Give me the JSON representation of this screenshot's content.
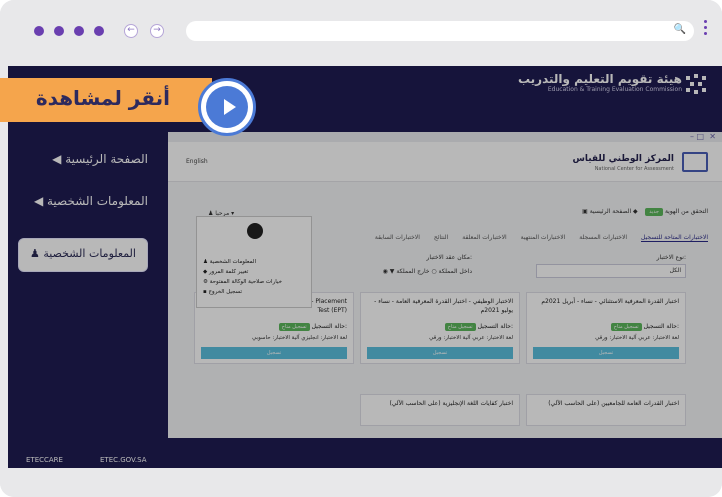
{
  "browser": {
    "back_icon": "←",
    "forward_icon": "→",
    "search_icon": "🔍"
  },
  "brand": {
    "arabic": "هيئة تقويم التعليم والتدريب",
    "english": "Education & Training Evaluation Commission"
  },
  "cta": {
    "label": "أنقر لمشاهدة"
  },
  "sidebar": {
    "items": [
      {
        "label": "◀ الصفحة الرئيسية"
      },
      {
        "label": "◀ المعلومات الشخصية"
      }
    ],
    "active_label": "♟ المعلومات الشخصية"
  },
  "footer": {
    "link1": "ETECCARE",
    "link2": "ETEC.GOV.SA"
  },
  "app": {
    "header_ar": "المركز الوطني للقياس",
    "header_en": "National Center for Assessment",
    "lang_label": "English",
    "crumb_home": "◆ الصفحة الرئيسية",
    "crumb_badge": "جديد",
    "crumb_link": "▣ التحقق من الهوية",
    "user_label": "♟ مرحبا ▾",
    "tabs": [
      "الاختبارات المتاحة للتسجيل",
      "الاختبارات المسجلة",
      "الاختبارات المنتهية",
      "الاختبارات المعلقة",
      "النتائج",
      "الاختبارات السابقة"
    ],
    "filter_type_label": "نوع الاختبار:",
    "filter_type_value": "الكل",
    "filter_place_label": "مكان عقد الاختبار:",
    "filter_place_value": "◉ ▼ داخل المملكة    ○ خارج المملكة"
  },
  "cards": [
    {
      "title": "اختبار القدرة المعرفية الاستثنائي - نساء - أبريل 2021م",
      "status_label": "حالة التسجيل:",
      "status_badge": "تسجيل متاح",
      "meta": "لغة الاختبار: عربي    آلية الاختبار: ورقي",
      "button": "تسجيل"
    },
    {
      "title": "الاختبار الوظيفي - اختبار القدرة المعرفية العامة - نساء - يوليو 2021م",
      "status_label": "حالة التسجيل:",
      "status_badge": "تسجيل متاح",
      "meta": "لغة الاختبار: عربي    آلية الاختبار: ورقي",
      "button": "تسجيل"
    },
    {
      "title": "اختبار تحديد مستوى اللغة الإنجليزية - EPT - Placement Test (EPT)",
      "status_label": "حالة التسجيل:",
      "status_badge": "تسجيل متاح",
      "meta": "لغة الاختبار: انجليزي    آلية الاختبار: حاسوبي",
      "button": "تسجيل"
    },
    {
      "title": "اختبار القدرات العامة للجامعيين (على الحاسب الآلي)",
      "status_label": "",
      "status_badge": "",
      "meta": "",
      "button": ""
    },
    {
      "title": "اختبار كفايات اللغة الإنجليزية (على الحاسب الآلي)",
      "status_label": "",
      "status_badge": "",
      "meta": "",
      "button": ""
    }
  ],
  "menu": {
    "items": [
      "♟ المعلومات الشخصية",
      "◆ تغيير كلمة المرور",
      "⚙ خيارات صلاحية الوكالة المفتوحة",
      "▪ تسجيل الخروج"
    ]
  }
}
